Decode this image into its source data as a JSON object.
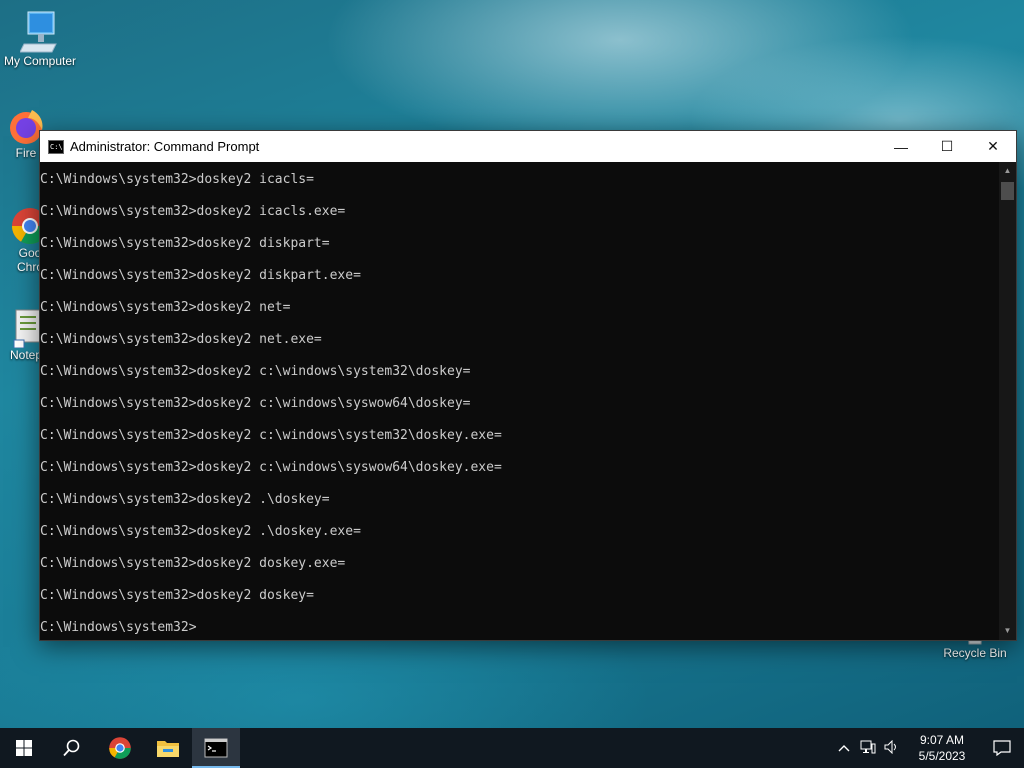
{
  "desktop": {
    "icons": [
      {
        "label": "My Computer",
        "icon": "computer-icon"
      },
      {
        "label": "Fire",
        "icon": "firefox-icon"
      },
      {
        "label": "Goo\nChro",
        "icon": "chrome-icon"
      },
      {
        "label": "Notep",
        "icon": "notepad-icon"
      },
      {
        "label": "Recycle Bin",
        "icon": "recycle-bin-icon"
      }
    ]
  },
  "window": {
    "title": "Administrator: Command Prompt",
    "minimize": "—",
    "maximize": "☐",
    "close": "✕"
  },
  "console": {
    "lines": [
      "C:\\Windows\\system32>doskey2 icacls=",
      "C:\\Windows\\system32>doskey2 icacls.exe=",
      "C:\\Windows\\system32>doskey2 diskpart=",
      "C:\\Windows\\system32>doskey2 diskpart.exe=",
      "C:\\Windows\\system32>doskey2 net=",
      "C:\\Windows\\system32>doskey2 net.exe=",
      "C:\\Windows\\system32>doskey2 c:\\windows\\system32\\doskey=",
      "C:\\Windows\\system32>doskey2 c:\\windows\\syswow64\\doskey=",
      "C:\\Windows\\system32>doskey2 c:\\windows\\system32\\doskey.exe=",
      "C:\\Windows\\system32>doskey2 c:\\windows\\syswow64\\doskey.exe=",
      "C:\\Windows\\system32>doskey2 .\\doskey=",
      "C:\\Windows\\system32>doskey2 .\\doskey.exe=",
      "C:\\Windows\\system32>doskey2 doskey.exe=",
      "C:\\Windows\\system32>doskey2 doskey=",
      "C:\\Windows\\system32>"
    ]
  },
  "taskbar": {
    "buttons": [
      "start-icon",
      "search-icon",
      "chrome-icon",
      "file-explorer-icon",
      "command-prompt-icon"
    ],
    "clock": {
      "time": "9:07 AM",
      "date": "5/5/2023"
    }
  }
}
